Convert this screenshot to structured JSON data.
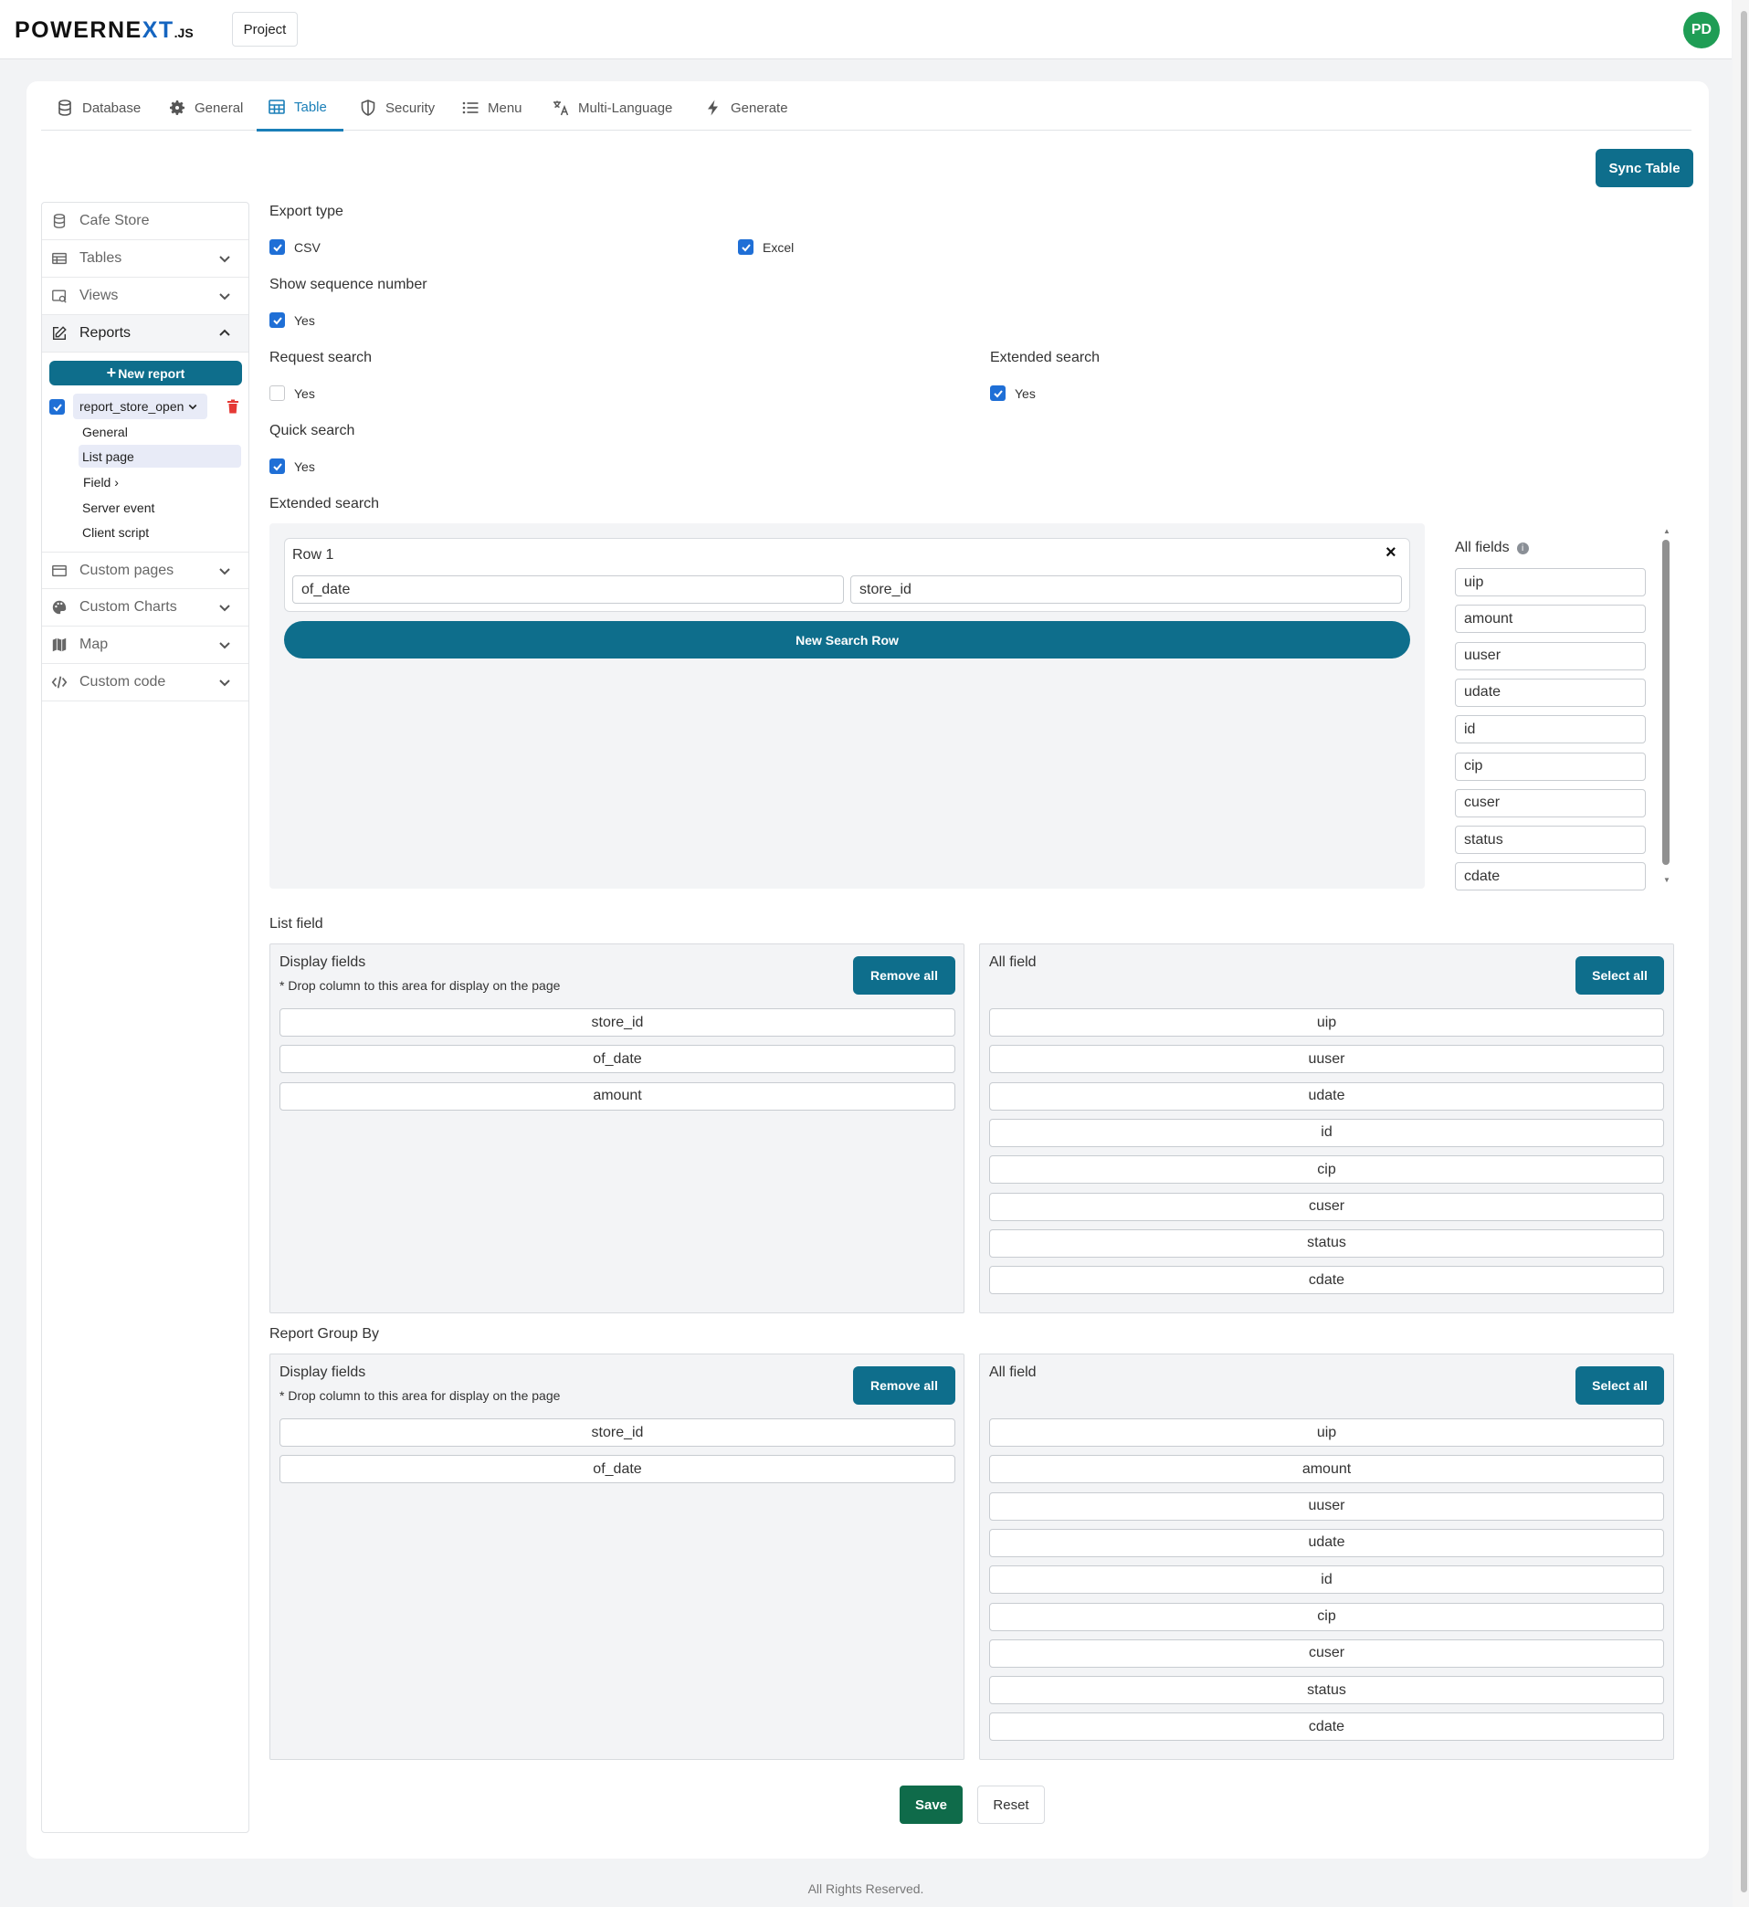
{
  "app": {
    "logo": {
      "part1": "POWERNE",
      "part2": "XT",
      "part3": ".JS"
    },
    "project_button": "Project",
    "avatar_initials": "PD",
    "accent_color": "#0e6e8c"
  },
  "tabs": [
    {
      "label": "Database",
      "icon": "database-icon"
    },
    {
      "label": "General",
      "icon": "gear-icon"
    },
    {
      "label": "Table",
      "icon": "table-icon",
      "active": true
    },
    {
      "label": "Security",
      "icon": "shield-icon"
    },
    {
      "label": "Menu",
      "icon": "list-icon"
    },
    {
      "label": "Multi-Language",
      "icon": "translate-icon"
    },
    {
      "label": "Generate",
      "icon": "bolt-icon"
    }
  ],
  "sync_button": "Sync Table",
  "sidebar": {
    "items": [
      {
        "label": "Cafe Store",
        "icon": "database-icon"
      },
      {
        "label": "Tables",
        "icon": "table-icon"
      },
      {
        "label": "Views",
        "icon": "views-icon"
      },
      {
        "label": "Reports",
        "icon": "edit-icon"
      },
      {
        "label": "Custom pages",
        "icon": "page-icon"
      },
      {
        "label": "Custom Charts",
        "icon": "palette-icon"
      },
      {
        "label": "Map",
        "icon": "map-icon"
      },
      {
        "label": "Custom code",
        "icon": "code-icon"
      }
    ],
    "new_report": "New report",
    "report_name": "report_store_open",
    "sub_links": [
      "General",
      "List page",
      "Field",
      "Server event",
      "Client script"
    ]
  },
  "form": {
    "export_type": {
      "label": "Export type",
      "csv": "CSV",
      "excel": "Excel"
    },
    "show_sequence": {
      "label": "Show sequence number",
      "yes": "Yes"
    },
    "request_search": {
      "label": "Request search",
      "yes": "Yes"
    },
    "extended_search_toggle": {
      "label": "Extended search",
      "yes": "Yes"
    },
    "quick_search": {
      "label": "Quick search",
      "yes": "Yes"
    },
    "extended_search_section": "Extended search"
  },
  "search_builder": {
    "row_title": "Row 1",
    "fields": [
      "of_date",
      "store_id"
    ],
    "new_row_button": "New Search Row",
    "all_fields_title": "All fields",
    "all_fields": [
      "uip",
      "amount",
      "uuser",
      "udate",
      "id",
      "cip",
      "cuser",
      "status",
      "cdate"
    ]
  },
  "list_field": {
    "title": "List field",
    "display_title": "Display fields",
    "hint": "* Drop column to this area for display on the page",
    "remove_all": "Remove all",
    "display_fields": [
      "store_id",
      "of_date",
      "amount"
    ],
    "all_title": "All field",
    "select_all": "Select all",
    "all_fields": [
      "uip",
      "uuser",
      "udate",
      "id",
      "cip",
      "cuser",
      "status",
      "cdate"
    ]
  },
  "group_by": {
    "title": "Report Group By",
    "display_title": "Display fields",
    "hint": "* Drop column to this area for display on the page",
    "remove_all": "Remove all",
    "display_fields": [
      "store_id",
      "of_date"
    ],
    "all_title": "All field",
    "select_all": "Select all",
    "all_fields": [
      "uip",
      "amount",
      "uuser",
      "udate",
      "id",
      "cip",
      "cuser",
      "status",
      "cdate"
    ]
  },
  "actions": {
    "save": "Save",
    "reset": "Reset"
  },
  "footer": "All Rights Reserved."
}
